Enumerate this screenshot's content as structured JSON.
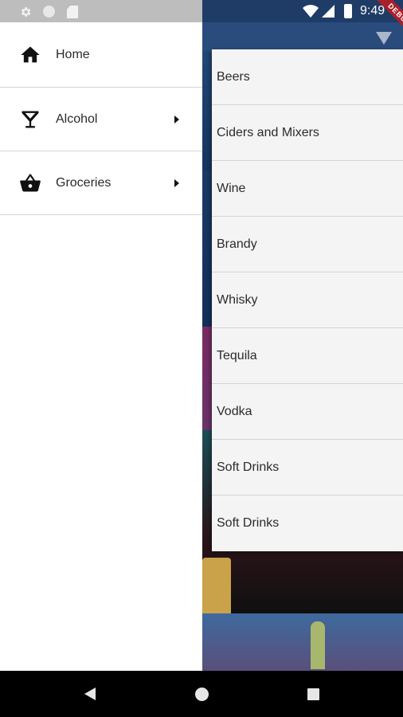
{
  "status_bar": {
    "time": "9:49"
  },
  "debug_banner": "DEBUG",
  "drawer": {
    "items": [
      {
        "label": "Home",
        "icon": "home-icon",
        "has_submenu": false
      },
      {
        "label": "Alcohol",
        "icon": "cocktail-glass-icon",
        "has_submenu": true
      },
      {
        "label": "Groceries",
        "icon": "shopping-basket-icon",
        "has_submenu": true
      }
    ]
  },
  "submenu": {
    "parent": "Alcohol",
    "items": [
      "Beers",
      "Ciders and Mixers",
      "Wine",
      "Brandy",
      "Whisky",
      "Tequila",
      "Vodka",
      "Soft Drinks",
      "Soft Drinks"
    ]
  },
  "colors": {
    "drawer_bg": "#ffffff",
    "submenu_bg": "#f4f4f4",
    "status_bar_left": "#bdbdbd",
    "app_primary": "#1f3c66",
    "debug_ribbon": "#a9202b"
  }
}
